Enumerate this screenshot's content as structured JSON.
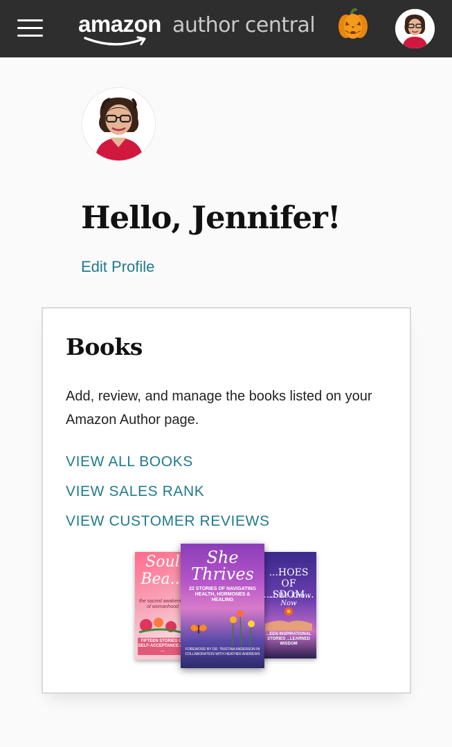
{
  "header": {
    "brand_primary": "amazon",
    "brand_secondary": "author central",
    "menu_icon": "hamburger-menu-icon",
    "seasonal_icon": "pumpkin-icon",
    "avatar_icon": "user-avatar"
  },
  "profile": {
    "greeting": "Hello, Jennifer!",
    "edit_link": "Edit Profile"
  },
  "books_card": {
    "title": "Books",
    "description": "Add, review, and manage the books listed on your Amazon Author page.",
    "links": [
      "VIEW ALL BOOKS",
      "VIEW SALES RANK",
      "VIEW CUSTOMER REVIEWS"
    ],
    "covers": [
      {
        "title": "Soul Bea...",
        "subtitle": "the sacred awakening of womanhood",
        "footer": "FIFTEEN STORIES OF SELF-ACCEPTANCE and ..."
      },
      {
        "title": "She Thrives",
        "subtitle": "22 STORIES OF NAVIGATING HEALTH, HORMONES & HEALING",
        "footer": "FOREWORD BY DR. TRISTINA ANDERSON IN COLLABORATION WITH HEATHER ANDREWS"
      },
      {
        "title": "...HOES OF ...SDOM...",
        "subtitle": "...t We Know Now",
        "footer": "...EEN INSPIRATIONAL STORIES ...LEARNED WISDOM"
      }
    ]
  },
  "colors": {
    "topbar": "#2e2e2e",
    "link": "#1f7a8c",
    "background": "#fafafa"
  }
}
